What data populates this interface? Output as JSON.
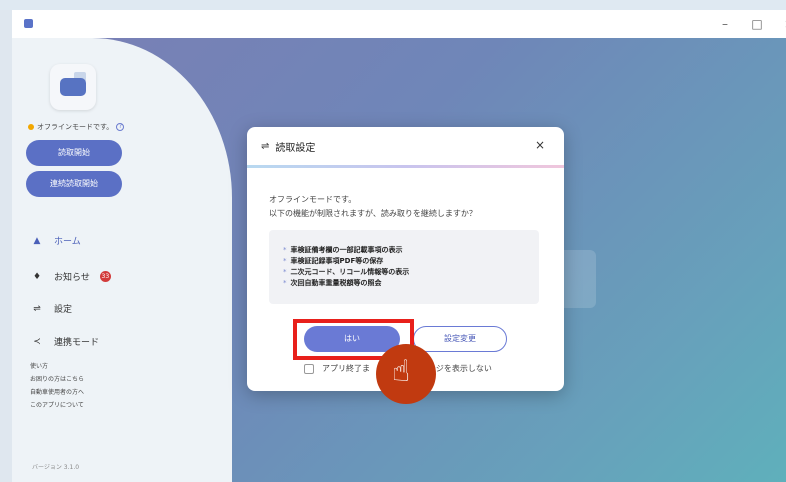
{
  "window": {
    "controls": {
      "minimize": "–",
      "maximize": "□",
      "close": "×"
    }
  },
  "sidebar": {
    "status": {
      "text": "オフラインモードです。",
      "help_icon": "?"
    },
    "buttons": {
      "read_start": "読取開始",
      "continuous_read_start": "連続読取開始"
    },
    "nav": [
      {
        "label": "ホーム",
        "icon": "home-icon"
      },
      {
        "label": "お知らせ",
        "icon": "bell-icon",
        "badge": "33"
      },
      {
        "label": "設定",
        "icon": "settings-sliders-icon"
      },
      {
        "label": "連携モード",
        "icon": "share-icon"
      }
    ],
    "links": [
      "使い方",
      "お困りの方はこちら",
      "自動車使用者の方へ",
      "このアプリについて"
    ],
    "version": "バージョン 3.1.0"
  },
  "dialog": {
    "title": "読取設定",
    "close": "×",
    "message_line1": "オフラインモードです。",
    "message_line2": "以下の機能が制限されますが、読み取りを継続しますか？",
    "restrictions": [
      "車検証備考欄の一部記載事項の表示",
      "車検証記録事項PDF等の保存",
      "二次元コード、リコール情報等の表示",
      "次回自動車重量税額等の照会"
    ],
    "yes_button": "はい",
    "change_settings_button": "設定変更",
    "checkbox_label_left": "アプリ終了ま",
    "checkbox_label_right": "ージを表示しない"
  },
  "colors": {
    "accent": "#5b70c5",
    "highlight": "#e8201b",
    "pointer": "#c13a10"
  }
}
